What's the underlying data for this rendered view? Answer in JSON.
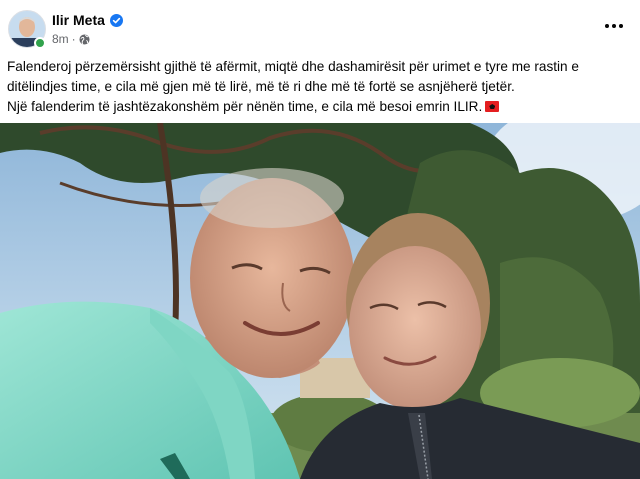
{
  "post": {
    "author": "Ilir Meta",
    "time": "8m",
    "separator": "·",
    "audience_icon": "globe-icon",
    "verified_icon": "verified-badge-icon",
    "more_icon": "more-options-icon",
    "text_line_1": "Falenderoj përzemërsisht gjithë të afërmit, miqtë dhe dashamirësit për urimet e tyre me rastin e ditëlindjes time, e cila më gjen më të lirë, më të ri dhe më të fortë se asnjëherë tjetër.",
    "text_line_2": "Një falenderim të jashtëzakonshëm për nënën time, e cila më besoi emrin ILIR.",
    "flag_icon": "albania-flag-icon"
  },
  "colors": {
    "accent": "#1877f2",
    "secondary_text": "#65676b",
    "online": "#31a24c"
  }
}
